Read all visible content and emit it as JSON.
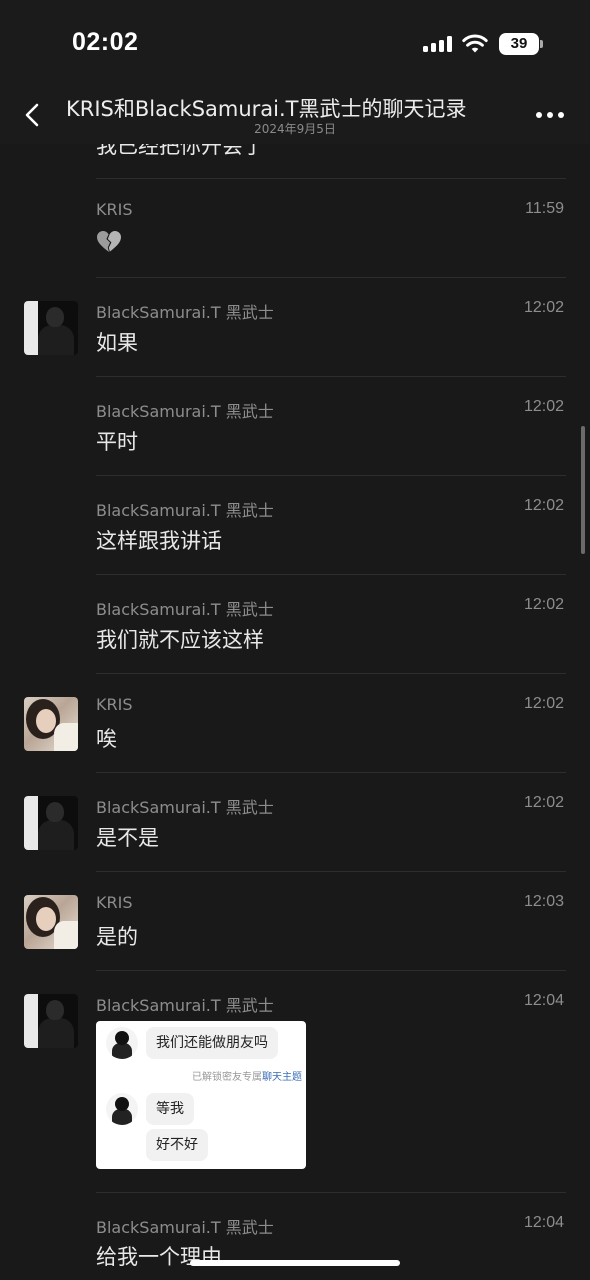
{
  "status_bar": {
    "time": "02:02",
    "battery": "39"
  },
  "nav": {
    "title": "KRIS和BlackSamurai.T黑武士的聊天记录",
    "subtitle": "2024年9月5日"
  },
  "messages": [
    {
      "text": "我已经把你开会了"
    },
    {
      "sender": "KRIS",
      "time": "11:59"
    },
    {
      "sender": "BlackSamurai.T 黑武士",
      "time": "12:02",
      "text": "如果"
    },
    {
      "sender": "BlackSamurai.T 黑武士",
      "time": "12:02",
      "text": "平时"
    },
    {
      "sender": "BlackSamurai.T 黑武士",
      "time": "12:02",
      "text": "这样跟我讲话"
    },
    {
      "sender": "BlackSamurai.T 黑武士",
      "time": "12:02",
      "text": "我们就不应该这样"
    },
    {
      "sender": "KRIS",
      "time": "12:02",
      "text": "唉"
    },
    {
      "sender": "BlackSamurai.T 黑武士",
      "time": "12:02",
      "text": "是不是"
    },
    {
      "sender": "KRIS",
      "time": "12:03",
      "text": "是的"
    },
    {
      "sender": "BlackSamurai.T 黑武士",
      "time": "12:04"
    },
    {
      "sender": "BlackSamurai.T 黑武士",
      "time": "12:04",
      "text": "给我一个理由"
    }
  ],
  "image_card": {
    "bubble_1": "我们还能做朋友吗",
    "system_prefix": "已解锁密友专属",
    "system_link": "聊天主题",
    "bubble_2": "等我",
    "bubble_3": "好不好"
  },
  "colors": {
    "background": "#191919",
    "text": "#e8e8e8",
    "meta": "#8d8d8d",
    "divider": "#2d2d2d",
    "link": "#3b6fb6"
  },
  "icons": [
    "back-icon",
    "more-icon",
    "signal-icon",
    "wifi-icon",
    "broken-heart-emoji"
  ]
}
